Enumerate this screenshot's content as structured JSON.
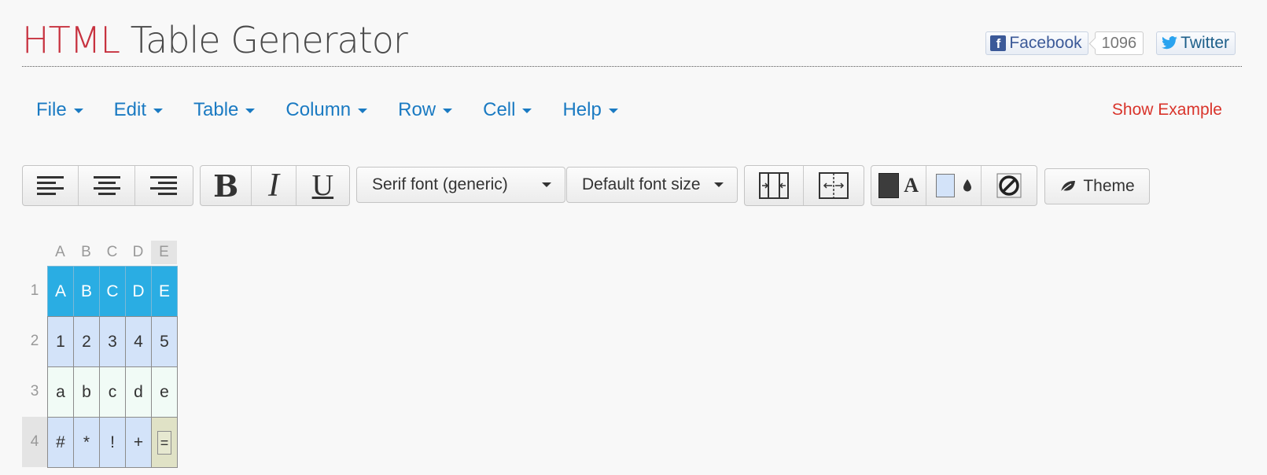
{
  "header": {
    "title_accent": "HTML",
    "title_rest": "Table Generator",
    "facebook_label": "Facebook",
    "facebook_count": "1096",
    "twitter_label": "Twitter"
  },
  "menu": {
    "items": [
      "File",
      "Edit",
      "Table",
      "Column",
      "Row",
      "Cell",
      "Help"
    ],
    "show_example": "Show Example"
  },
  "toolbar": {
    "font_family": "Serif font (generic)",
    "font_size": "Default font size",
    "theme_label": "Theme",
    "text_color": "#3c3c3c",
    "bg_color": "#d3e3f9",
    "icons": [
      "align-left-icon",
      "align-center-icon",
      "align-right-icon",
      "bold-icon",
      "italic-icon",
      "underline-icon",
      "merge-cells-icon",
      "split-cells-icon",
      "text-color-icon",
      "background-color-icon",
      "no-border-icon",
      "leaf-icon"
    ]
  },
  "grid": {
    "col_headers": [
      "A",
      "B",
      "C",
      "D",
      "E"
    ],
    "row_headers": [
      "1",
      "2",
      "3",
      "4"
    ],
    "rows": [
      [
        "A",
        "B",
        "C",
        "D",
        "E"
      ],
      [
        "1",
        "2",
        "3",
        "4",
        "5"
      ],
      [
        "a",
        "b",
        "c",
        "d",
        "e"
      ],
      [
        "#",
        "*",
        "!",
        "+",
        "="
      ]
    ],
    "header_color": "#2aade3",
    "even_row_color": "#d3e3f9",
    "odd_row_color": "#f1fbf6",
    "selected_cell": "E4"
  }
}
